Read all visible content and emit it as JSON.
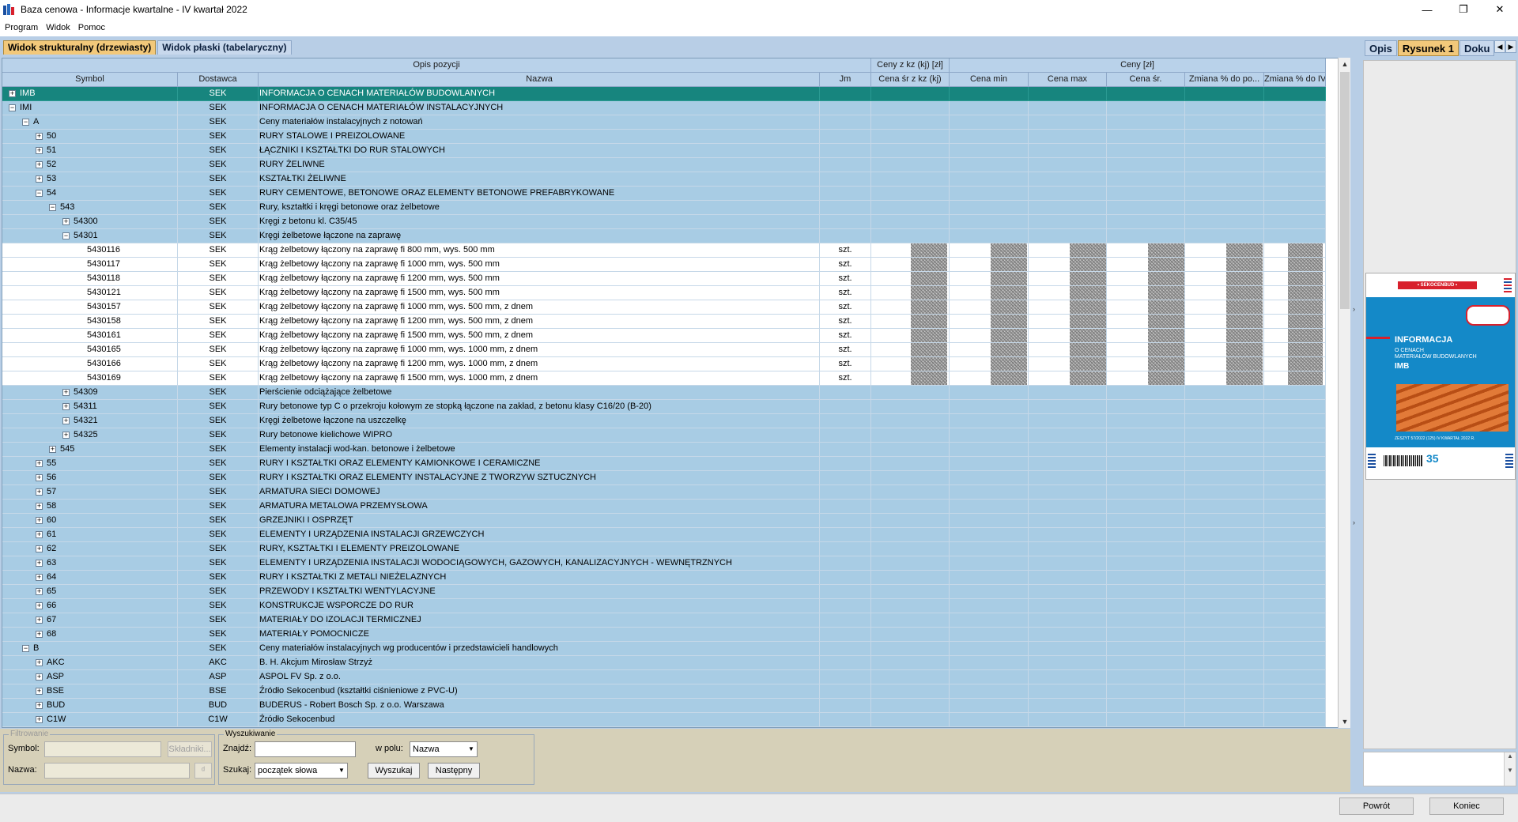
{
  "window": {
    "title": "Baza cenowa - Informacje kwartalne - IV kwartał 2022",
    "minimize": "—",
    "restore": "❐",
    "close": "✕"
  },
  "menu": [
    "Program",
    "Widok",
    "Pomoc"
  ],
  "tabs": [
    "Widok strukturalny (drzewiasty)",
    "Widok płaski (tabelaryczny)"
  ],
  "grid": {
    "group_headers": {
      "opis": "Opis pozycji",
      "ceny_kz": "Ceny z kz (kj) [zł]",
      "ceny": "Ceny [zł]"
    },
    "columns": [
      "Symbol",
      "Dostawca",
      "Nazwa",
      "Jm",
      "Cena śr z kz (kj)",
      "Cena min",
      "Cena max",
      "Cena śr.",
      "Zmiana % do po...",
      "Zmiana % do IV ..."
    ],
    "rows": [
      {
        "sym": "IMB",
        "lvl": 0,
        "exp": "+",
        "dost": "SEK",
        "nazwa": "INFORMACJA O CENACH MATERIAŁÓW BUDOWLANYCH",
        "jm": "",
        "t": "sel"
      },
      {
        "sym": "IMI",
        "lvl": 0,
        "exp": "−",
        "dost": "SEK",
        "nazwa": "INFORMACJA O CENACH MATERIAŁÓW INSTALACYJNYCH",
        "jm": "",
        "t": "sec"
      },
      {
        "sym": "A",
        "lvl": 1,
        "exp": "−",
        "dost": "SEK",
        "nazwa": "Ceny materiałów instalacyjnych z notowań",
        "jm": "",
        "t": "sec"
      },
      {
        "sym": "50",
        "lvl": 2,
        "exp": "+",
        "dost": "SEK",
        "nazwa": "RURY STALOWE I PREIZOLOWANE",
        "jm": "",
        "t": "sec"
      },
      {
        "sym": "51",
        "lvl": 2,
        "exp": "+",
        "dost": "SEK",
        "nazwa": "ŁĄCZNIKI I KSZTAŁTKI DO RUR STALOWYCH",
        "jm": "",
        "t": "sec"
      },
      {
        "sym": "52",
        "lvl": 2,
        "exp": "+",
        "dost": "SEK",
        "nazwa": "RURY ŻELIWNE",
        "jm": "",
        "t": "sec"
      },
      {
        "sym": "53",
        "lvl": 2,
        "exp": "+",
        "dost": "SEK",
        "nazwa": "KSZTAŁTKI ŻELIWNE",
        "jm": "",
        "t": "sec"
      },
      {
        "sym": "54",
        "lvl": 2,
        "exp": "−",
        "dost": "SEK",
        "nazwa": "RURY CEMENTOWE, BETONOWE ORAZ ELEMENTY BETONOWE PREFABRYKOWANE",
        "jm": "",
        "t": "sec"
      },
      {
        "sym": "543",
        "lvl": 3,
        "exp": "−",
        "dost": "SEK",
        "nazwa": "Rury, kształtki i kręgi betonowe oraz żelbetowe",
        "jm": "",
        "t": "sec"
      },
      {
        "sym": "54300",
        "lvl": 4,
        "exp": "+",
        "dost": "SEK",
        "nazwa": "Kręgi z betonu kl. C35/45",
        "jm": "",
        "t": "sec"
      },
      {
        "sym": "54301",
        "lvl": 4,
        "exp": "−",
        "dost": "SEK",
        "nazwa": "Kręgi żelbetowe łączone na zaprawę",
        "jm": "",
        "t": "sec"
      },
      {
        "sym": "5430116",
        "lvl": 5,
        "exp": "",
        "dost": "SEK",
        "nazwa": "Krąg żelbetowy łączony na zaprawę fi 800 mm, wys. 500 mm",
        "jm": "szt.",
        "t": "item"
      },
      {
        "sym": "5430117",
        "lvl": 5,
        "exp": "",
        "dost": "SEK",
        "nazwa": "Krąg żelbetowy łączony na zaprawę fi 1000 mm, wys. 500 mm",
        "jm": "szt.",
        "t": "item"
      },
      {
        "sym": "5430118",
        "lvl": 5,
        "exp": "",
        "dost": "SEK",
        "nazwa": "Krąg żelbetowy łączony na zaprawę fi 1200 mm, wys. 500 mm",
        "jm": "szt.",
        "t": "item"
      },
      {
        "sym": "5430121",
        "lvl": 5,
        "exp": "",
        "dost": "SEK",
        "nazwa": "Krąg żelbetowy łączony na zaprawę fi 1500 mm, wys. 500 mm",
        "jm": "szt.",
        "t": "item"
      },
      {
        "sym": "5430157",
        "lvl": 5,
        "exp": "",
        "dost": "SEK",
        "nazwa": "Krąg żelbetowy łączony na zaprawę fi 1000 mm, wys. 500 mm, z dnem",
        "jm": "szt.",
        "t": "item"
      },
      {
        "sym": "5430158",
        "lvl": 5,
        "exp": "",
        "dost": "SEK",
        "nazwa": "Krąg żelbetowy łączony na zaprawę fi 1200 mm, wys. 500 mm, z dnem",
        "jm": "szt.",
        "t": "item"
      },
      {
        "sym": "5430161",
        "lvl": 5,
        "exp": "",
        "dost": "SEK",
        "nazwa": "Krąg żelbetowy łączony na zaprawę fi 1500 mm, wys. 500 mm, z dnem",
        "jm": "szt.",
        "t": "item"
      },
      {
        "sym": "5430165",
        "lvl": 5,
        "exp": "",
        "dost": "SEK",
        "nazwa": "Krąg żelbetowy łączony na zaprawę fi 1000 mm, wys. 1000 mm, z dnem",
        "jm": "szt.",
        "t": "item"
      },
      {
        "sym": "5430166",
        "lvl": 5,
        "exp": "",
        "dost": "SEK",
        "nazwa": "Krąg żelbetowy łączony na zaprawę fi 1200 mm, wys. 1000 mm, z dnem",
        "jm": "szt.",
        "t": "item"
      },
      {
        "sym": "5430169",
        "lvl": 5,
        "exp": "",
        "dost": "SEK",
        "nazwa": "Krąg żelbetowy łączony na zaprawę fi 1500 mm, wys. 1000 mm, z dnem",
        "jm": "szt.",
        "t": "item"
      },
      {
        "sym": "54309",
        "lvl": 4,
        "exp": "+",
        "dost": "SEK",
        "nazwa": "Pierścienie odciążające żelbetowe",
        "jm": "",
        "t": "sec"
      },
      {
        "sym": "54311",
        "lvl": 4,
        "exp": "+",
        "dost": "SEK",
        "nazwa": "Rury betonowe typ C o przekroju kołowym ze stopką łączone na zakład, z betonu klasy C16/20 (B-20)",
        "jm": "",
        "t": "sec"
      },
      {
        "sym": "54321",
        "lvl": 4,
        "exp": "+",
        "dost": "SEK",
        "nazwa": "Kręgi żelbetowe łączone na uszczelkę",
        "jm": "",
        "t": "sec"
      },
      {
        "sym": "54325",
        "lvl": 4,
        "exp": "+",
        "dost": "SEK",
        "nazwa": "Rury betonowe kielichowe WIPRO",
        "jm": "",
        "t": "sec"
      },
      {
        "sym": "545",
        "lvl": 3,
        "exp": "+",
        "dost": "SEK",
        "nazwa": "Elementy instalacji wod-kan. betonowe i żelbetowe",
        "jm": "",
        "t": "sec"
      },
      {
        "sym": "55",
        "lvl": 2,
        "exp": "+",
        "dost": "SEK",
        "nazwa": "RURY I KSZTAŁTKI ORAZ ELEMENTY KAMIONKOWE I CERAMICZNE",
        "jm": "",
        "t": "sec"
      },
      {
        "sym": "56",
        "lvl": 2,
        "exp": "+",
        "dost": "SEK",
        "nazwa": "RURY I KSZTAŁTKI ORAZ ELEMENTY INSTALACYJNE Z TWORZYW SZTUCZNYCH",
        "jm": "",
        "t": "sec"
      },
      {
        "sym": "57",
        "lvl": 2,
        "exp": "+",
        "dost": "SEK",
        "nazwa": "ARMATURA SIECI DOMOWEJ",
        "jm": "",
        "t": "sec"
      },
      {
        "sym": "58",
        "lvl": 2,
        "exp": "+",
        "dost": "SEK",
        "nazwa": "ARMATURA METALOWA PRZEMYSŁOWA",
        "jm": "",
        "t": "sec"
      },
      {
        "sym": "60",
        "lvl": 2,
        "exp": "+",
        "dost": "SEK",
        "nazwa": "GRZEJNIKI I OSPRZĘT",
        "jm": "",
        "t": "sec"
      },
      {
        "sym": "61",
        "lvl": 2,
        "exp": "+",
        "dost": "SEK",
        "nazwa": "ELEMENTY I URZĄDZENIA INSTALACJI GRZEWCZYCH",
        "jm": "",
        "t": "sec"
      },
      {
        "sym": "62",
        "lvl": 2,
        "exp": "+",
        "dost": "SEK",
        "nazwa": "RURY, KSZTAŁTKI I ELEMENTY PREIZOLOWANE",
        "jm": "",
        "t": "sec"
      },
      {
        "sym": "63",
        "lvl": 2,
        "exp": "+",
        "dost": "SEK",
        "nazwa": "ELEMENTY I URZĄDZENIA INSTALACJI WODOCIĄGOWYCH, GAZOWYCH, KANALIZACYJNYCH - WEWNĘTRZNYCH",
        "jm": "",
        "t": "sec"
      },
      {
        "sym": "64",
        "lvl": 2,
        "exp": "+",
        "dost": "SEK",
        "nazwa": "RURY I KSZTAŁTKI Z METALI NIEŻELAZNYCH",
        "jm": "",
        "t": "sec"
      },
      {
        "sym": "65",
        "lvl": 2,
        "exp": "+",
        "dost": "SEK",
        "nazwa": "PRZEWODY I KSZTAŁTKI WENTYLACYJNE",
        "jm": "",
        "t": "sec"
      },
      {
        "sym": "66",
        "lvl": 2,
        "exp": "+",
        "dost": "SEK",
        "nazwa": "KONSTRUKCJE WSPORCZE DO RUR",
        "jm": "",
        "t": "sec"
      },
      {
        "sym": "67",
        "lvl": 2,
        "exp": "+",
        "dost": "SEK",
        "nazwa": "MATERIAŁY DO IZOLACJI TERMICZNEJ",
        "jm": "",
        "t": "sec"
      },
      {
        "sym": "68",
        "lvl": 2,
        "exp": "+",
        "dost": "SEK",
        "nazwa": "MATERIAŁY POMOCNICZE",
        "jm": "",
        "t": "sec"
      },
      {
        "sym": "B",
        "lvl": 1,
        "exp": "−",
        "dost": "SEK",
        "nazwa": "Ceny materiałów instalacyjnych wg producentów i przedstawicieli handlowych",
        "jm": "",
        "t": "sec"
      },
      {
        "sym": "AKC",
        "lvl": 2,
        "exp": "+",
        "dost": "AKC",
        "nazwa": "B. H. Akcjum Mirosław Strzyż",
        "jm": "",
        "t": "sec"
      },
      {
        "sym": "ASP",
        "lvl": 2,
        "exp": "+",
        "dost": "ASP",
        "nazwa": "ASPOL FV Sp. z o.o.",
        "jm": "",
        "t": "sec"
      },
      {
        "sym": "BSE",
        "lvl": 2,
        "exp": "+",
        "dost": "BSE",
        "nazwa": "Źródło Sekocenbud (kształtki ciśnieniowe z PVC-U)",
        "jm": "",
        "t": "sec"
      },
      {
        "sym": "BUD",
        "lvl": 2,
        "exp": "+",
        "dost": "BUD",
        "nazwa": "BUDERUS - Robert Bosch Sp. z o.o. Warszawa",
        "jm": "",
        "t": "sec"
      },
      {
        "sym": "C1W",
        "lvl": 2,
        "exp": "+",
        "dost": "C1W",
        "nazwa": "Źródło Sekocenbud",
        "jm": "",
        "t": "sec"
      }
    ]
  },
  "right_panel": {
    "tabs": [
      "Opis",
      "Rysunek 1",
      "Doku"
    ],
    "cover": {
      "brand": "• SEKOCENBUD •",
      "title": "INFORMACJA",
      "sub1": "O CENACH",
      "sub2": "MATERIAŁÓW BUDOWLANYCH",
      "imb": "IMB",
      "issue": "ZESZYT 57/2022 (125)   IV KWARTAŁ 2022 R.",
      "anniv": "35"
    }
  },
  "filter": {
    "group": "Filtrowanie",
    "symbol_label": "Symbol:",
    "skladniki": "Składniki...",
    "nazwa_label": "Nazwa:"
  },
  "search": {
    "group": "Wyszukiwanie",
    "znajdz_label": "Znajdź:",
    "wpolu_label": "w polu:",
    "wpolu_value": "Nazwa",
    "szukaj_label": "Szukaj:",
    "szukaj_value": "początek słowa",
    "btn_search": "Wyszukaj",
    "btn_next": "Następny"
  },
  "footer": {
    "back": "Powrót",
    "end": "Koniec"
  }
}
